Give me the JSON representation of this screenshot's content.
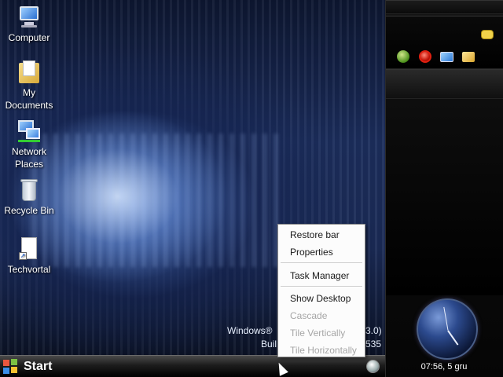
{
  "desktop": {
    "icons": [
      {
        "label": "Computer"
      },
      {
        "label": "My Documents"
      },
      {
        "label": "Network Places"
      },
      {
        "label": "Recycle Bin"
      },
      {
        "label": "Techvortal"
      }
    ],
    "version": {
      "line1_left": "Windows®",
      "line1_right": "3.0)",
      "line2_left": "Buil",
      "line2_right": "535"
    }
  },
  "context_menu": {
    "items": [
      {
        "label": "Restore bar",
        "enabled": true
      },
      {
        "label": "Properties",
        "enabled": true
      },
      {
        "label": "Task Manager",
        "enabled": true
      },
      {
        "label": "Show Desktop",
        "enabled": true
      },
      {
        "label": "Cascade",
        "enabled": false
      },
      {
        "label": "Tile Vertically",
        "enabled": false
      },
      {
        "label": "Tile Horizontally",
        "enabled": false
      }
    ]
  },
  "taskbar": {
    "start_label": "Start"
  },
  "sidebar": {
    "clock_text": "07:56, 5 gru",
    "toolbar_icons": [
      "green-orb-icon",
      "opera-icon",
      "monitor-icon",
      "folder-icon"
    ]
  },
  "colors": {
    "menu_bg": "#fcfcfc",
    "disabled_text": "#a6a6a6",
    "sidebar_bg": "#0b0b0b"
  }
}
